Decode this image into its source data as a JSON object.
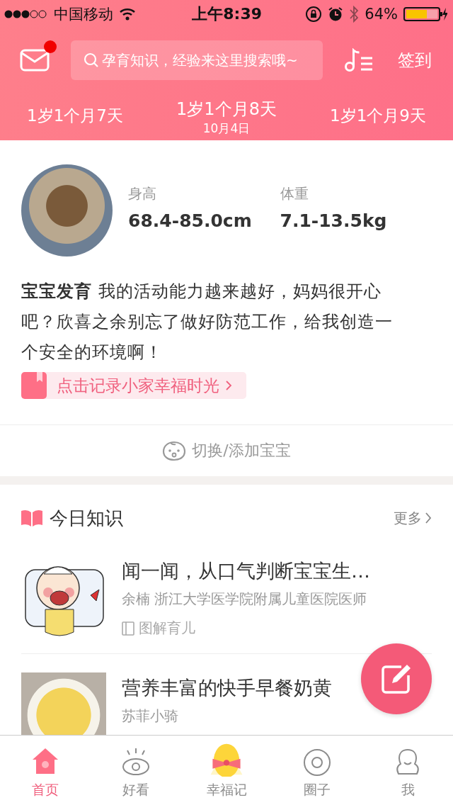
{
  "status_bar": {
    "carrier": "中国移动",
    "time": "上午8:39",
    "battery": "64%"
  },
  "header": {
    "mail_unread": true,
    "search": {
      "placeholder": "孕育知识，经验来这里搜索哦~"
    },
    "checkin": "签到"
  },
  "dates": [
    {
      "label": "1岁1个月7天",
      "selected": false
    },
    {
      "label": "1岁1个月8天",
      "date": "10月4日",
      "selected": true
    },
    {
      "label": "1岁1个月9天",
      "selected": false
    }
  ],
  "baby": {
    "stats": [
      {
        "label": "身高",
        "value": "68.4-85.0cm"
      },
      {
        "label": "体重",
        "value": "7.1-13.5kg"
      }
    ],
    "development": "**宝宝发育**  我的活动能力越来越好，妈妈很开心吧？欣喜之余别忘了做好防范工作，给我创造一个安全的环境啊！",
    "record_link": "点击记录小家幸福时光",
    "switch": "切换/添加宝宝"
  },
  "knowledge": {
    "title": "今日知识",
    "more": "更多",
    "articles": [
      {
        "title": "闻一闻，从口气判断宝宝生…",
        "author": "余楠  浙江大学医学院附属儿童医院医师",
        "source": "图解育儿",
        "kind": "cartoon"
      },
      {
        "title": "营养丰富的快手早餐奶黄",
        "author": "苏菲小骑",
        "kind": "photo"
      }
    ]
  },
  "tabs": [
    {
      "label": "首页",
      "selected": true,
      "kind": "home"
    },
    {
      "label": "好看",
      "selected": false,
      "kind": "eye"
    },
    {
      "label": "幸福记",
      "selected": false,
      "kind": "egg"
    },
    {
      "label": "圈子",
      "selected": false,
      "kind": "ring"
    },
    {
      "label": "我",
      "selected": false,
      "kind": "person"
    }
  ]
}
